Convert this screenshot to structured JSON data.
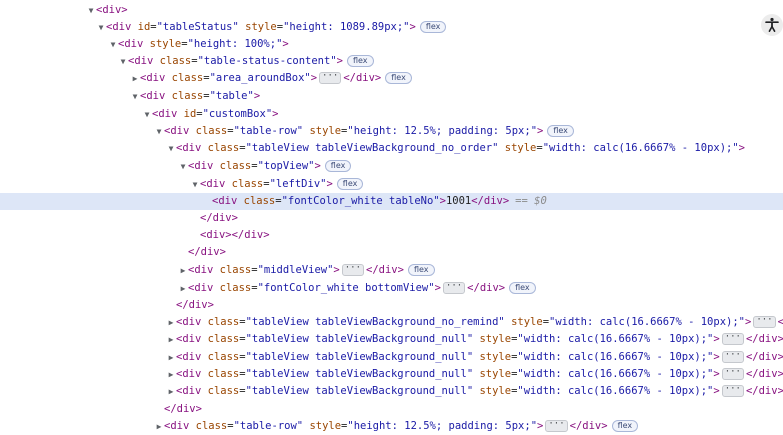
{
  "tree": {
    "rows": [
      {
        "tri": "▼",
        "html": "<span class='tag'>&lt;div&gt;</span>"
      },
      {
        "tri": "▼",
        "html": "<span class='tag'>&lt;div</span> <span class='an'>id</span>=<span class='av'>\"tableStatus\"</span> <span class='an'>style</span>=<span class='av'>\"height: 1089.89px;\"</span><span class='tag'>&gt;</span><span class='badge'>flex</span>"
      },
      {
        "tri": "▼",
        "html": "<span class='tag'>&lt;div</span> <span class='an'>style</span>=<span class='av'>\"height: 100%;\"</span><span class='tag'>&gt;</span>"
      },
      {
        "tri": "▼",
        "html": "<span class='tag'>&lt;div</span> <span class='an'>class</span>=<span class='av'>\"table-status-content\"</span><span class='tag'>&gt;</span><span class='badge'>flex</span>"
      },
      {
        "tri": "▶",
        "html": "<span class='tag'>&lt;div</span> <span class='an'>class</span>=<span class='av'>\"area_aroundBox\"</span><span class='tag'>&gt;</span><span class='ell'>···</span><span class='tag'>&lt;/div&gt;</span><span class='badge'>flex</span>"
      },
      {
        "tri": "▼",
        "html": "<span class='tag'>&lt;div</span> <span class='an'>class</span>=<span class='av'>\"table\"</span><span class='tag'>&gt;</span>"
      },
      {
        "tri": "▼",
        "html": "<span class='tag'>&lt;div</span> <span class='an'>id</span>=<span class='av'>\"customBox\"</span><span class='tag'>&gt;</span>"
      },
      {
        "tri": "▼",
        "html": "<span class='tag'>&lt;div</span> <span class='an'>class</span>=<span class='av'>\"table-row\"</span> <span class='an'>style</span>=<span class='av'>\"height: 12.5%; padding: 5px;\"</span><span class='tag'>&gt;</span><span class='badge'>flex</span>"
      },
      {
        "tri": "▼",
        "html": "<span class='tag'>&lt;div</span> <span class='an'>class</span>=<span class='av'>\"tableView tableViewBackground_no_order\"</span> <span class='an'>style</span>=<span class='av'>\"width: calc(16.6667% - 10px);\"</span><span class='tag'>&gt;</span>"
      },
      {
        "tri": "▼",
        "html": "<span class='tag'>&lt;div</span> <span class='an'>class</span>=<span class='av'>\"topView\"</span><span class='tag'>&gt;</span><span class='badge'>flex</span>"
      },
      {
        "tri": "▼",
        "html": "<span class='tag'>&lt;div</span> <span class='an'>class</span>=<span class='av'>\"leftDiv\"</span><span class='tag'>&gt;</span><span class='badge'>flex</span>"
      },
      {
        "tri": "",
        "html": "<span class='tag'>&lt;div</span> <span class='an'>class</span>=<span class='av'>\"fontColor_white tableNo\"</span><span class='tag'>&gt;</span><span class='txt'>1001</span><span class='tag'>&lt;/div&gt;</span><span class='dollar'>== $0</span>"
      },
      {
        "tri": "",
        "html": "<span class='tag'>&lt;/div&gt;</span>"
      },
      {
        "tri": "",
        "html": "<span class='tag'>&lt;div&gt;&lt;/div&gt;</span>"
      },
      {
        "tri": "",
        "html": "<span class='tag'>&lt;/div&gt;</span>"
      },
      {
        "tri": "▶",
        "html": "<span class='tag'>&lt;div</span> <span class='an'>class</span>=<span class='av'>\"middleView\"</span><span class='tag'>&gt;</span><span class='ell'>···</span><span class='tag'>&lt;/div&gt;</span><span class='badge'>flex</span>"
      },
      {
        "tri": "▶",
        "html": "<span class='tag'>&lt;div</span> <span class='an'>class</span>=<span class='av'>\"fontColor_white bottomView\"</span><span class='tag'>&gt;</span><span class='ell'>···</span><span class='tag'>&lt;/div&gt;</span><span class='badge'>flex</span>"
      },
      {
        "tri": "",
        "html": "<span class='tag'>&lt;/div&gt;</span>"
      },
      {
        "tri": "▶",
        "html": "<span class='tag'>&lt;div</span> <span class='an'>class</span>=<span class='av'>\"tableView tableViewBackground_no_remind\"</span> <span class='an'>style</span>=<span class='av'>\"width: calc(16.6667% - 10px);\"</span><span class='tag'>&gt;</span><span class='ell'>···</span><span class='tag'>&lt;/div&gt;</span>"
      },
      {
        "tri": "▶",
        "html": "<span class='tag'>&lt;div</span> <span class='an'>class</span>=<span class='av'>\"tableView tableViewBackground_null\"</span> <span class='an'>style</span>=<span class='av'>\"width: calc(16.6667% - 10px);\"</span><span class='tag'>&gt;</span><span class='ell'>···</span><span class='tag'>&lt;/div&gt;</span>"
      },
      {
        "tri": "▶",
        "html": "<span class='tag'>&lt;div</span> <span class='an'>class</span>=<span class='av'>\"tableView tableViewBackground_null\"</span> <span class='an'>style</span>=<span class='av'>\"width: calc(16.6667% - 10px);\"</span><span class='tag'>&gt;</span><span class='ell'>···</span><span class='tag'>&lt;/div&gt;</span>"
      },
      {
        "tri": "▶",
        "html": "<span class='tag'>&lt;div</span> <span class='an'>class</span>=<span class='av'>\"tableView tableViewBackground_null\"</span> <span class='an'>style</span>=<span class='av'>\"width: calc(16.6667% - 10px);\"</span><span class='tag'>&gt;</span><span class='ell'>···</span><span class='tag'>&lt;/div&gt;</span>"
      },
      {
        "tri": "▶",
        "html": "<span class='tag'>&lt;div</span> <span class='an'>class</span>=<span class='av'>\"tableView tableViewBackground_null\"</span> <span class='an'>style</span>=<span class='av'>\"width: calc(16.6667% - 10px);\"</span><span class='tag'>&gt;</span><span class='ell'>···</span><span class='tag'>&lt;/div&gt;</span>"
      },
      {
        "tri": "",
        "html": "<span class='tag'>&lt;/div&gt;</span>"
      },
      {
        "tri": "▶",
        "html": "<span class='tag'>&lt;div</span> <span class='an'>class</span>=<span class='av'>\"table-row\"</span> <span class='an'>style</span>=<span class='av'>\"height: 12.5%; padding: 5px;\"</span><span class='tag'>&gt;</span><span class='ell'>···</span><span class='tag'>&lt;/div&gt;</span><span class='badge'>flex</span>"
      }
    ]
  },
  "colors": {
    "tag": "#881280",
    "attr_name": "#994500",
    "attr_value": "#1a1aa6",
    "selected_row": "#dde6f7"
  },
  "icons": {
    "accessibility": "accessibility-icon"
  }
}
